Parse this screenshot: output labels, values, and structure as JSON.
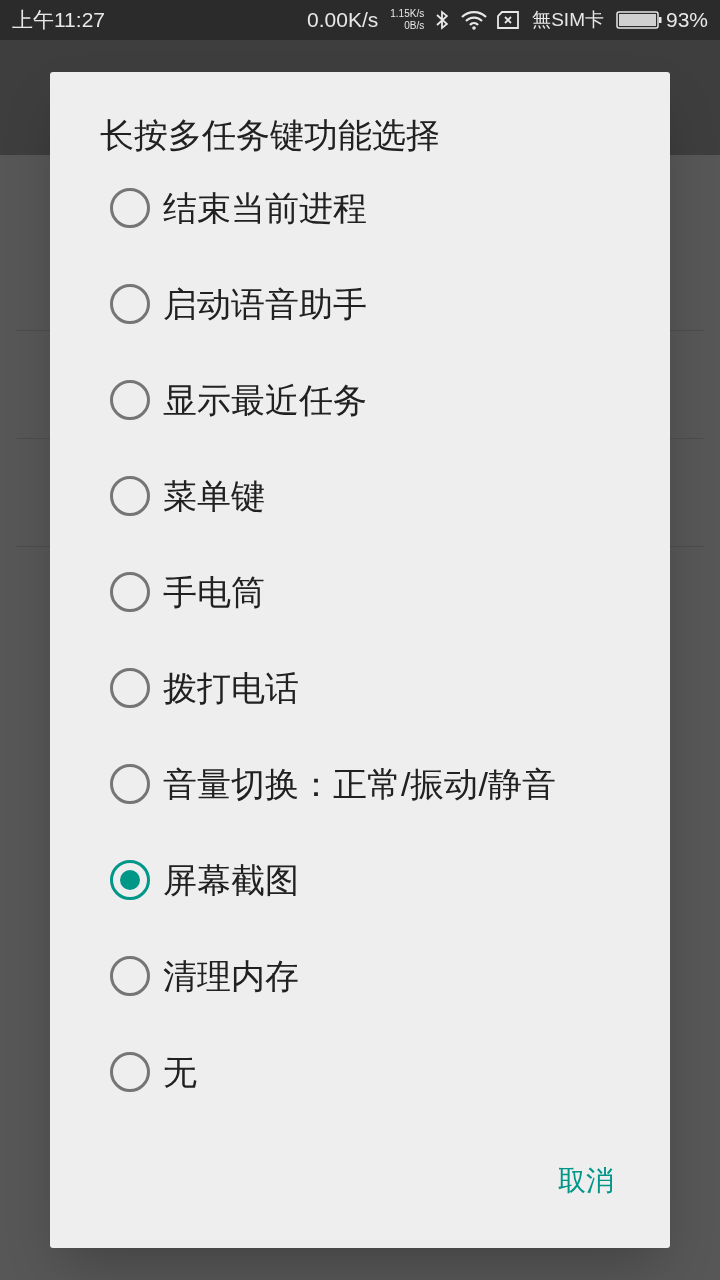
{
  "status_bar": {
    "time": "上午11:27",
    "speed": "0.00K/s",
    "up_speed": "1.15K/s",
    "down_speed": "0B/s",
    "sim": "無SIM卡",
    "battery": "93%"
  },
  "dialog": {
    "title": "长按多任务键功能选择",
    "options": [
      {
        "label": "结束当前进程",
        "selected": false
      },
      {
        "label": "启动语音助手",
        "selected": false
      },
      {
        "label": "显示最近任务",
        "selected": false
      },
      {
        "label": "菜单键",
        "selected": false
      },
      {
        "label": "手电筒",
        "selected": false
      },
      {
        "label": "拨打电话",
        "selected": false
      },
      {
        "label": "音量切换：正常/振动/静音",
        "selected": false
      },
      {
        "label": "屏幕截图",
        "selected": true
      },
      {
        "label": "清理内存",
        "selected": false
      },
      {
        "label": "无",
        "selected": false
      }
    ],
    "cancel": "取消"
  }
}
